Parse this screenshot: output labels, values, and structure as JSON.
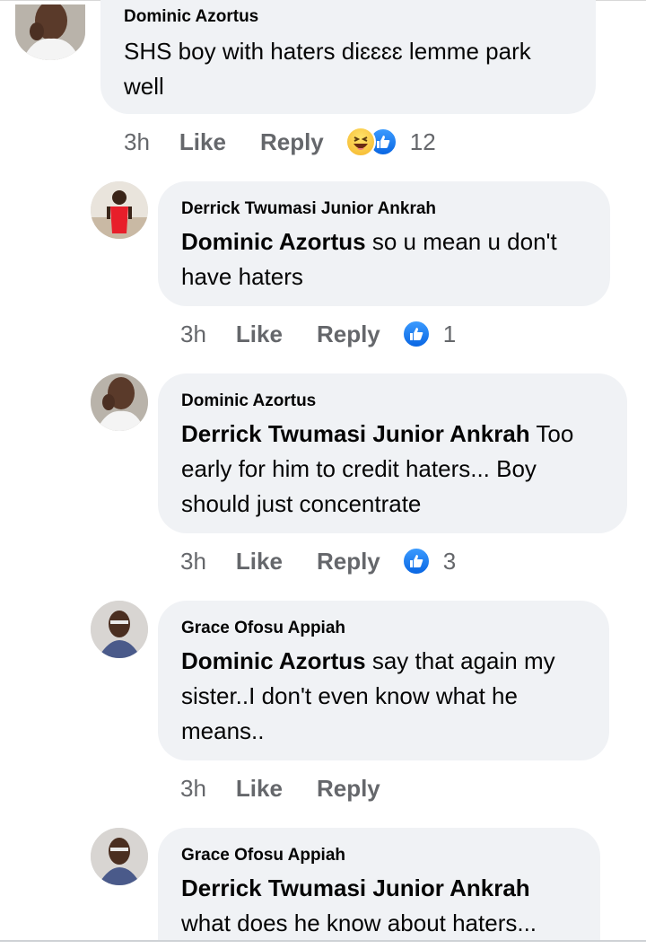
{
  "colors": {
    "bubble": "#f0f2f5",
    "meta": "#65676b",
    "like_blue": "#1877f2"
  },
  "comments": [
    {
      "author": "Dominic Azortus",
      "mention": "",
      "text": "SHS boy with haters diɛɛɛɛ lemme park well",
      "time": "3h",
      "like": "Like",
      "reply": "Reply",
      "reactions": [
        "haha-icon",
        "like-icon"
      ],
      "reaction_count": "12"
    },
    {
      "author": "Derrick Twumasi Junior Ankrah",
      "mention": "Dominic Azortus",
      "text": " so u mean u don't have haters",
      "time": "3h",
      "like": "Like",
      "reply": "Reply",
      "reactions": [
        "like-icon"
      ],
      "reaction_count": "1"
    },
    {
      "author": "Dominic Azortus",
      "mention": "Derrick Twumasi Junior Ankrah",
      "text": " Too early for him to credit haters... Boy should just concentrate",
      "time": "3h",
      "like": "Like",
      "reply": "Reply",
      "reactions": [
        "like-icon"
      ],
      "reaction_count": "3"
    },
    {
      "author": "Grace Ofosu Appiah",
      "mention": "Dominic Azortus",
      "text": " say that again my sister..I don't even know what he means..",
      "time": "3h",
      "like": "Like",
      "reply": "Reply",
      "reactions": [],
      "reaction_count": ""
    },
    {
      "author": "Grace Ofosu Appiah",
      "mention": "Derrick Twumasi Junior Ankrah",
      "text": " what does he know about haters...",
      "time": "",
      "like": "",
      "reply": "",
      "reactions": [],
      "reaction_count": ""
    }
  ]
}
